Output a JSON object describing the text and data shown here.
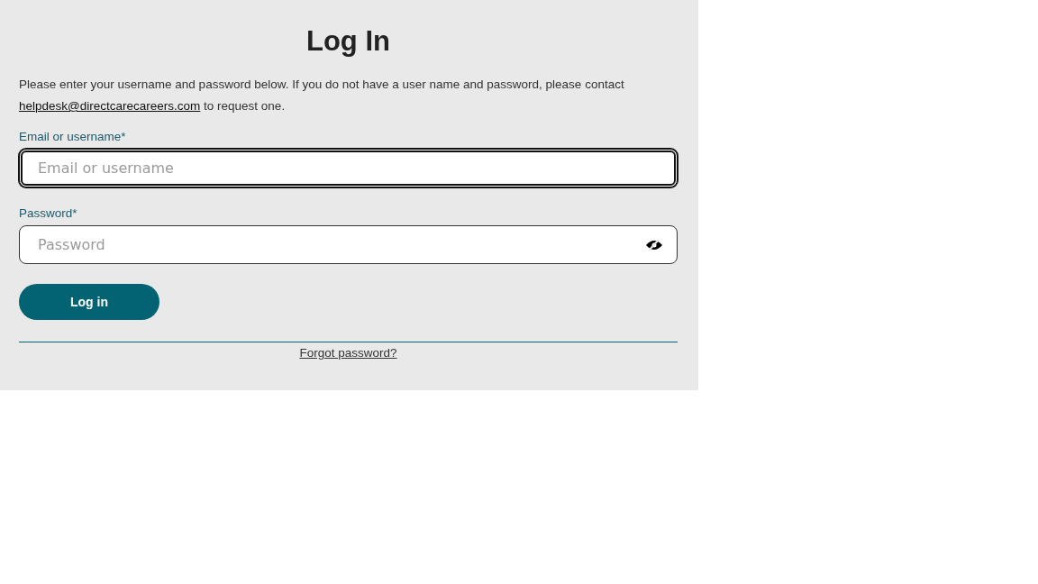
{
  "title": "Log In",
  "intro": {
    "before": "Please enter your username and password below. If you do not have a user name and password, please contact",
    "link": "helpdesk@directcarecareers.com",
    "after": "to request one."
  },
  "fields": [
    {
      "label": "Email or username",
      "required_mark": "*",
      "placeholder": "Email or username",
      "focused": true,
      "kind": "text"
    },
    {
      "label": "Password",
      "required_mark": "*",
      "placeholder": "Password",
      "focused": false,
      "kind": "password"
    }
  ],
  "submit": "Log in",
  "forgot": "Forgot password?"
}
